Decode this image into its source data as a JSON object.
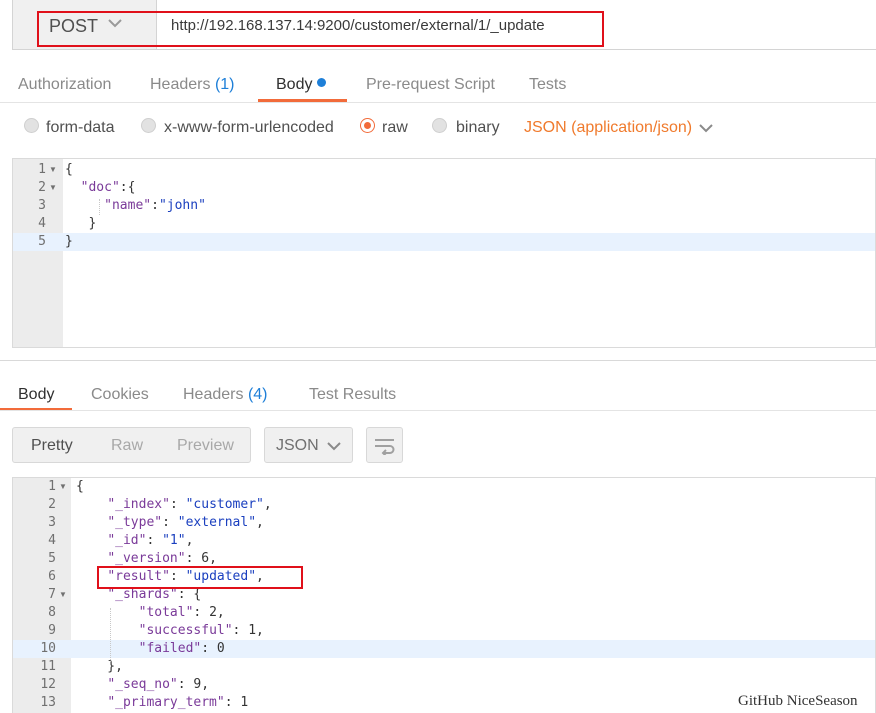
{
  "request": {
    "method": "POST",
    "url": "http://192.168.137.14:9200/customer/external/1/_update"
  },
  "request_tabs": [
    {
      "label": "Authorization"
    },
    {
      "label": "Headers",
      "count": "(1)"
    },
    {
      "label": "Body"
    },
    {
      "label": "Pre-request Script"
    },
    {
      "label": "Tests"
    }
  ],
  "body_types": {
    "options": [
      "form-data",
      "x-www-form-urlencoded",
      "raw",
      "binary"
    ],
    "selected": "raw",
    "content_type": "JSON (application/json)"
  },
  "request_body": {
    "lines": [
      [
        [
          "p",
          "{"
        ]
      ],
      [
        [
          "p",
          "  "
        ],
        [
          "key",
          "\"doc\""
        ],
        [
          "p",
          ":{"
        ]
      ],
      [
        [
          "p",
          "     "
        ],
        [
          "key",
          "\"name\""
        ],
        [
          "p",
          ":"
        ],
        [
          "str",
          "\"john\""
        ]
      ],
      [
        [
          "p",
          "   }"
        ]
      ],
      [
        [
          "p",
          "}"
        ]
      ]
    ],
    "line_numbers": [
      "1",
      "2",
      "3",
      "4",
      "5"
    ]
  },
  "response_tabs": [
    {
      "label": "Body"
    },
    {
      "label": "Cookies"
    },
    {
      "label": "Headers",
      "count": "(4)"
    },
    {
      "label": "Test Results"
    }
  ],
  "response_view": {
    "modes": [
      "Pretty",
      "Raw",
      "Preview"
    ],
    "selected": "Pretty",
    "format": "JSON"
  },
  "response_body": {
    "lines": [
      [
        [
          "p",
          "{"
        ]
      ],
      [
        [
          "p",
          "    "
        ],
        [
          "key",
          "\"_index\""
        ],
        [
          "p",
          ": "
        ],
        [
          "str",
          "\"customer\""
        ],
        [
          "p",
          ","
        ]
      ],
      [
        [
          "p",
          "    "
        ],
        [
          "key",
          "\"_type\""
        ],
        [
          "p",
          ": "
        ],
        [
          "str",
          "\"external\""
        ],
        [
          "p",
          ","
        ]
      ],
      [
        [
          "p",
          "    "
        ],
        [
          "key",
          "\"_id\""
        ],
        [
          "p",
          ": "
        ],
        [
          "str",
          "\"1\""
        ],
        [
          "p",
          ","
        ]
      ],
      [
        [
          "p",
          "    "
        ],
        [
          "key",
          "\"_version\""
        ],
        [
          "p",
          ": "
        ],
        [
          "num",
          "6"
        ],
        [
          "p",
          ","
        ]
      ],
      [
        [
          "p",
          "    "
        ],
        [
          "key",
          "\"result\""
        ],
        [
          "p",
          ": "
        ],
        [
          "str",
          "\"updated\""
        ],
        [
          "p",
          ","
        ]
      ],
      [
        [
          "p",
          "    "
        ],
        [
          "key",
          "\"_shards\""
        ],
        [
          "p",
          ": {"
        ]
      ],
      [
        [
          "p",
          "        "
        ],
        [
          "key",
          "\"total\""
        ],
        [
          "p",
          ": "
        ],
        [
          "num",
          "2"
        ],
        [
          "p",
          ","
        ]
      ],
      [
        [
          "p",
          "        "
        ],
        [
          "key",
          "\"successful\""
        ],
        [
          "p",
          ": "
        ],
        [
          "num",
          "1"
        ],
        [
          "p",
          ","
        ]
      ],
      [
        [
          "p",
          "        "
        ],
        [
          "key",
          "\"failed\""
        ],
        [
          "p",
          ": "
        ],
        [
          "num",
          "0"
        ]
      ],
      [
        [
          "p",
          "    },"
        ]
      ],
      [
        [
          "p",
          "    "
        ],
        [
          "key",
          "\"_seq_no\""
        ],
        [
          "p",
          ": "
        ],
        [
          "num",
          "9"
        ],
        [
          "p",
          ","
        ]
      ],
      [
        [
          "p",
          "    "
        ],
        [
          "key",
          "\"_primary_term\""
        ],
        [
          "p",
          ": "
        ],
        [
          "num",
          "1"
        ]
      ]
    ],
    "line_numbers": [
      "1",
      "2",
      "3",
      "4",
      "5",
      "6",
      "7",
      "8",
      "9",
      "10",
      "11",
      "12",
      "13"
    ]
  },
  "watermark": "GitHub NiceSeason",
  "colors": {
    "accent": "#f26b3a",
    "count_blue": "#1e7fd8",
    "highlight_red": "#e0101a",
    "json_key": "#7a3a99",
    "json_string": "#1a3fbf"
  }
}
